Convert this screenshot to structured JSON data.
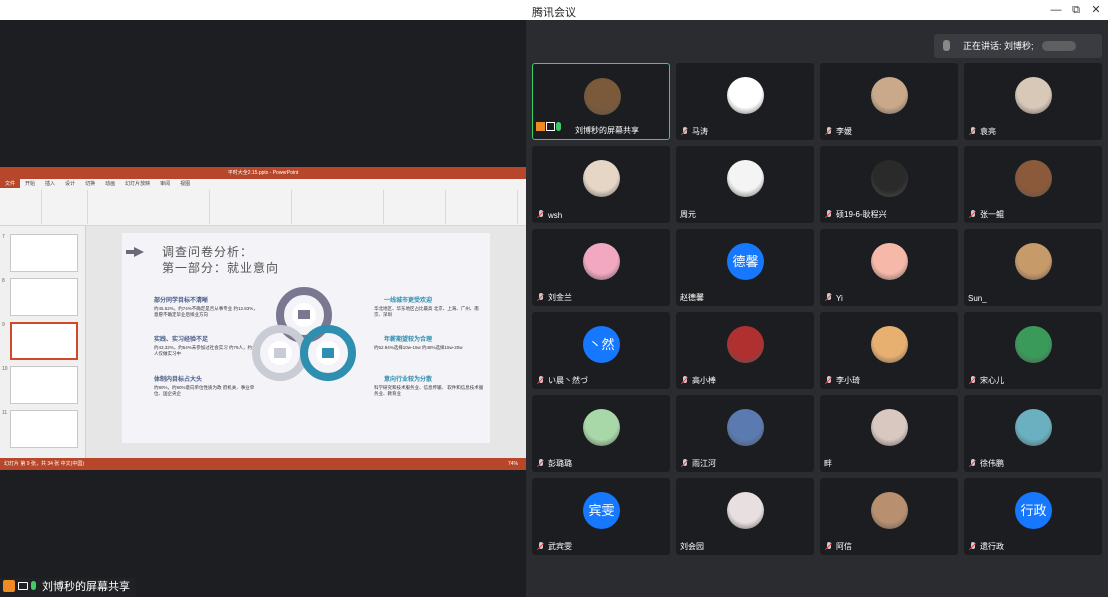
{
  "window": {
    "title": "腾讯会议",
    "min": "—",
    "max": "⧉",
    "close": "✕"
  },
  "shared_screen": {
    "ppt_title": "平时大全2.15.pptx - PowerPoint",
    "tabs": [
      "文件",
      "开始",
      "插入",
      "设计",
      "切换",
      "动画",
      "幻灯片放映",
      "审阅",
      "视图"
    ],
    "slide_numbers": [
      "7",
      "8",
      "9",
      "10",
      "11"
    ],
    "slide": {
      "title_line1": "调查问卷分析：",
      "title_line2": "第一部分：就业意向",
      "left_blocks": [
        {
          "head": "部分同学目标不清晰",
          "text": "约45.52%，约74%不确定是否从事专业 约12.83%，意愿不确定毕业后择业方向"
        },
        {
          "head": "实践、实习经验不足",
          "text": "约43.32%，约54%未参加过社会实习 约79人，约1人仅做实习中"
        },
        {
          "head": "体制内目标占大头",
          "text": "约80%，约90%意向单位性质为政 府机关、事业单位、国企央企"
        }
      ],
      "right_blocks": [
        {
          "head": "一线城市更受欢迎",
          "text": "华北地区、华东地区占比最高 北京、上海、广州、南京、深圳"
        },
        {
          "head": "年薪期望较为合理",
          "text": "约52.94%选择10w-15w 约48%选择15w-20w"
        },
        {
          "head": "意向行业较为分散",
          "text": "科学研究和技术服务业、信息传输、 软件和信息技术服务业、教育业"
        }
      ]
    },
    "status_text": "幻灯片 第 9 张，共 34 张   中文(中国)",
    "zoom": "74%"
  },
  "presenter_bar": {
    "label": "刘博秒的屏幕共享"
  },
  "speaking": {
    "label": "正在讲话: 刘博秒;"
  },
  "participants": [
    {
      "name": "刘博秒的屏幕共享",
      "avatar": "photo",
      "color": "#7a5a3a",
      "active": true,
      "sharing": true
    },
    {
      "name": "马涛",
      "avatar": "photo",
      "color": "#ffffff"
    },
    {
      "name": "李媛",
      "avatar": "photo",
      "color": "#c9a98a"
    },
    {
      "name": "袁亮",
      "avatar": "photo",
      "color": "#d8c8b8"
    },
    {
      "name": "wsh",
      "avatar": "photo",
      "color": "#e6d6c6"
    },
    {
      "name": "周元",
      "avatar": "photo",
      "color": "#f4f4f4",
      "no_mic": true
    },
    {
      "name": "硕19-6-耿程兴",
      "avatar": "photo",
      "color": "#2a2a2a"
    },
    {
      "name": "张一鲲",
      "avatar": "photo",
      "color": "#8a5a3a"
    },
    {
      "name": "刘金兰",
      "avatar": "photo",
      "color": "#f2a8c0"
    },
    {
      "name": "赵德馨",
      "avatar": "text",
      "text": "德馨",
      "no_mic": true
    },
    {
      "name": "Yi",
      "avatar": "photo",
      "color": "#f6b8a8"
    },
    {
      "name": "Sun_",
      "avatar": "photo",
      "color": "#c79a6a",
      "no_mic": true
    },
    {
      "name": "い晨丶然づ",
      "avatar": "text",
      "text": "丶然"
    },
    {
      "name": "高小棒",
      "avatar": "photo",
      "color": "#b03030"
    },
    {
      "name": "李小琦",
      "avatar": "photo",
      "color": "#e8b070"
    },
    {
      "name": "宋心儿",
      "avatar": "photo",
      "color": "#3a9a5a"
    },
    {
      "name": "彭璐璐",
      "avatar": "photo",
      "color": "#a8d8a8"
    },
    {
      "name": "雨江河",
      "avatar": "photo",
      "color": "#5a7ab0"
    },
    {
      "name": "畔",
      "avatar": "photo",
      "color": "#d8c8c0",
      "no_mic": true
    },
    {
      "name": "徐伟鹏",
      "avatar": "photo",
      "color": "#6ab0c0"
    },
    {
      "name": "武宾雯",
      "avatar": "text",
      "text": "宾雯"
    },
    {
      "name": "刘会园",
      "avatar": "photo",
      "color": "#e8e0e0",
      "no_mic": true
    },
    {
      "name": "阿信",
      "avatar": "photo",
      "color": "#b89070"
    },
    {
      "name": "遗行政",
      "avatar": "text",
      "text": "行政"
    }
  ]
}
